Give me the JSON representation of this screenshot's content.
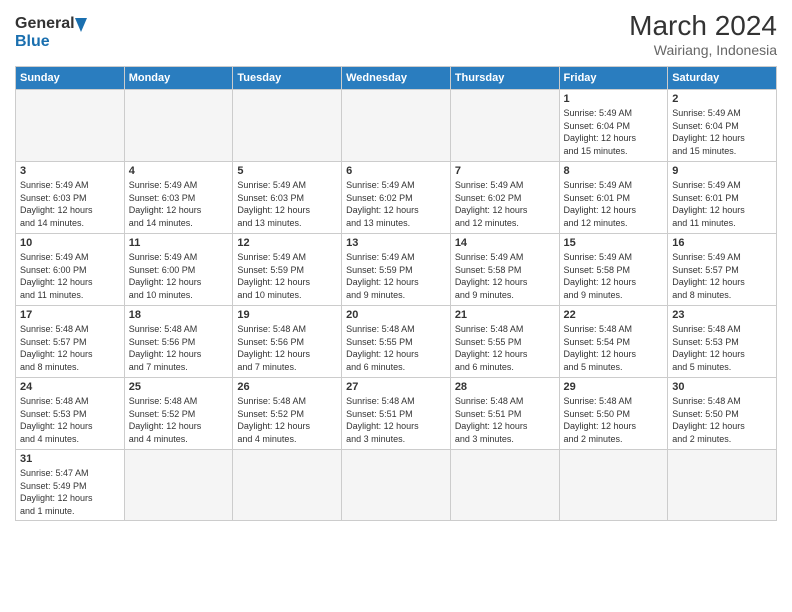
{
  "header": {
    "logo_general": "General",
    "logo_blue": "Blue",
    "month_title": "March 2024",
    "location": "Wairiang, Indonesia"
  },
  "weekdays": [
    "Sunday",
    "Monday",
    "Tuesday",
    "Wednesday",
    "Thursday",
    "Friday",
    "Saturday"
  ],
  "weeks": [
    [
      {
        "day": "",
        "info": ""
      },
      {
        "day": "",
        "info": ""
      },
      {
        "day": "",
        "info": ""
      },
      {
        "day": "",
        "info": ""
      },
      {
        "day": "",
        "info": ""
      },
      {
        "day": "1",
        "info": "Sunrise: 5:49 AM\nSunset: 6:04 PM\nDaylight: 12 hours\nand 15 minutes."
      },
      {
        "day": "2",
        "info": "Sunrise: 5:49 AM\nSunset: 6:04 PM\nDaylight: 12 hours\nand 15 minutes."
      }
    ],
    [
      {
        "day": "3",
        "info": "Sunrise: 5:49 AM\nSunset: 6:03 PM\nDaylight: 12 hours\nand 14 minutes."
      },
      {
        "day": "4",
        "info": "Sunrise: 5:49 AM\nSunset: 6:03 PM\nDaylight: 12 hours\nand 14 minutes."
      },
      {
        "day": "5",
        "info": "Sunrise: 5:49 AM\nSunset: 6:03 PM\nDaylight: 12 hours\nand 13 minutes."
      },
      {
        "day": "6",
        "info": "Sunrise: 5:49 AM\nSunset: 6:02 PM\nDaylight: 12 hours\nand 13 minutes."
      },
      {
        "day": "7",
        "info": "Sunrise: 5:49 AM\nSunset: 6:02 PM\nDaylight: 12 hours\nand 12 minutes."
      },
      {
        "day": "8",
        "info": "Sunrise: 5:49 AM\nSunset: 6:01 PM\nDaylight: 12 hours\nand 12 minutes."
      },
      {
        "day": "9",
        "info": "Sunrise: 5:49 AM\nSunset: 6:01 PM\nDaylight: 12 hours\nand 11 minutes."
      }
    ],
    [
      {
        "day": "10",
        "info": "Sunrise: 5:49 AM\nSunset: 6:00 PM\nDaylight: 12 hours\nand 11 minutes."
      },
      {
        "day": "11",
        "info": "Sunrise: 5:49 AM\nSunset: 6:00 PM\nDaylight: 12 hours\nand 10 minutes."
      },
      {
        "day": "12",
        "info": "Sunrise: 5:49 AM\nSunset: 5:59 PM\nDaylight: 12 hours\nand 10 minutes."
      },
      {
        "day": "13",
        "info": "Sunrise: 5:49 AM\nSunset: 5:59 PM\nDaylight: 12 hours\nand 9 minutes."
      },
      {
        "day": "14",
        "info": "Sunrise: 5:49 AM\nSunset: 5:58 PM\nDaylight: 12 hours\nand 9 minutes."
      },
      {
        "day": "15",
        "info": "Sunrise: 5:49 AM\nSunset: 5:58 PM\nDaylight: 12 hours\nand 9 minutes."
      },
      {
        "day": "16",
        "info": "Sunrise: 5:49 AM\nSunset: 5:57 PM\nDaylight: 12 hours\nand 8 minutes."
      }
    ],
    [
      {
        "day": "17",
        "info": "Sunrise: 5:48 AM\nSunset: 5:57 PM\nDaylight: 12 hours\nand 8 minutes."
      },
      {
        "day": "18",
        "info": "Sunrise: 5:48 AM\nSunset: 5:56 PM\nDaylight: 12 hours\nand 7 minutes."
      },
      {
        "day": "19",
        "info": "Sunrise: 5:48 AM\nSunset: 5:56 PM\nDaylight: 12 hours\nand 7 minutes."
      },
      {
        "day": "20",
        "info": "Sunrise: 5:48 AM\nSunset: 5:55 PM\nDaylight: 12 hours\nand 6 minutes."
      },
      {
        "day": "21",
        "info": "Sunrise: 5:48 AM\nSunset: 5:55 PM\nDaylight: 12 hours\nand 6 minutes."
      },
      {
        "day": "22",
        "info": "Sunrise: 5:48 AM\nSunset: 5:54 PM\nDaylight: 12 hours\nand 5 minutes."
      },
      {
        "day": "23",
        "info": "Sunrise: 5:48 AM\nSunset: 5:53 PM\nDaylight: 12 hours\nand 5 minutes."
      }
    ],
    [
      {
        "day": "24",
        "info": "Sunrise: 5:48 AM\nSunset: 5:53 PM\nDaylight: 12 hours\nand 4 minutes."
      },
      {
        "day": "25",
        "info": "Sunrise: 5:48 AM\nSunset: 5:52 PM\nDaylight: 12 hours\nand 4 minutes."
      },
      {
        "day": "26",
        "info": "Sunrise: 5:48 AM\nSunset: 5:52 PM\nDaylight: 12 hours\nand 4 minutes."
      },
      {
        "day": "27",
        "info": "Sunrise: 5:48 AM\nSunset: 5:51 PM\nDaylight: 12 hours\nand 3 minutes."
      },
      {
        "day": "28",
        "info": "Sunrise: 5:48 AM\nSunset: 5:51 PM\nDaylight: 12 hours\nand 3 minutes."
      },
      {
        "day": "29",
        "info": "Sunrise: 5:48 AM\nSunset: 5:50 PM\nDaylight: 12 hours\nand 2 minutes."
      },
      {
        "day": "30",
        "info": "Sunrise: 5:48 AM\nSunset: 5:50 PM\nDaylight: 12 hours\nand 2 minutes."
      }
    ],
    [
      {
        "day": "31",
        "info": "Sunrise: 5:47 AM\nSunset: 5:49 PM\nDaylight: 12 hours\nand 1 minute."
      },
      {
        "day": "",
        "info": ""
      },
      {
        "day": "",
        "info": ""
      },
      {
        "day": "",
        "info": ""
      },
      {
        "day": "",
        "info": ""
      },
      {
        "day": "",
        "info": ""
      },
      {
        "day": "",
        "info": ""
      }
    ]
  ]
}
